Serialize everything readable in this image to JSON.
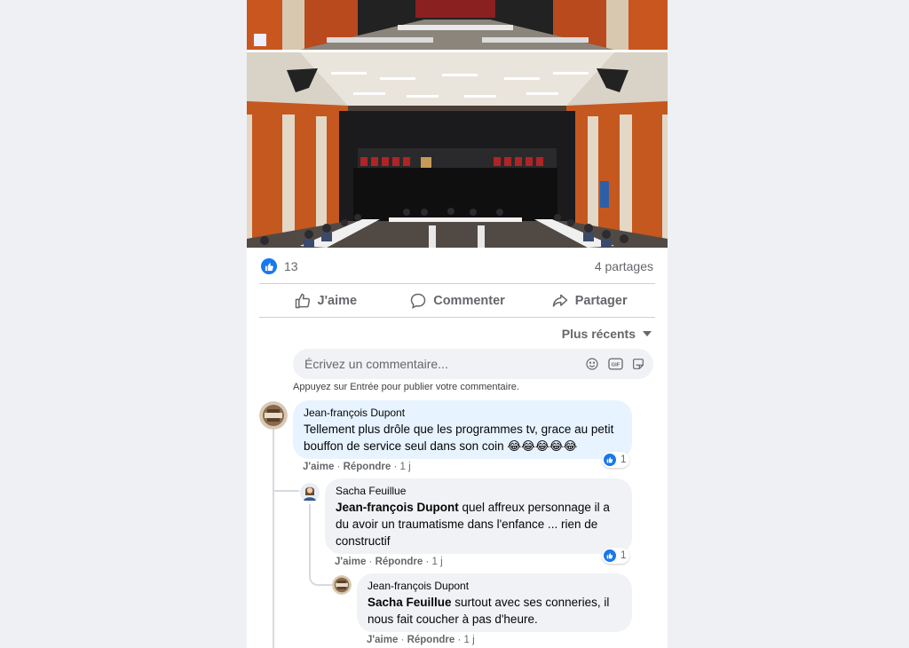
{
  "post": {
    "reaction_count": "13",
    "shares": "4 partages",
    "actions": {
      "like": "J'aime",
      "comment": "Commenter",
      "share": "Partager"
    }
  },
  "comments_section": {
    "sort_label": "Plus récents",
    "composer_placeholder": "Écrivez un commentaire...",
    "composer_hint": "Appuyez sur Entrée pour publier votre commentaire."
  },
  "comments": [
    {
      "author": "Jean-françois Dupont",
      "text": "Tellement plus drôle que les programmes tv, grace au petit bouffon de service seul dans son coin 😂😂😂😂😂",
      "like": "J'aime",
      "reply": "Répondre",
      "time": "1 j",
      "reactions": "1"
    },
    {
      "author": "Sacha Feuillue",
      "mention": "Jean-françois Dupont",
      "text": " quel affreux personnage il a du avoir un traumatisme dans l'enfance ... rien de constructif",
      "like": "J'aime",
      "reply": "Répondre",
      "time": "1 j",
      "reactions": "1"
    },
    {
      "author": "Jean-françois Dupont",
      "mention": "Sacha Feuillue",
      "text": " surtout avec ses conneries, il nous fait coucher à pas d'heure.",
      "like": "J'aime",
      "reply": "Répondre",
      "time": "1 j"
    }
  ],
  "colors": {
    "accent": "#1877f2",
    "secondary_text": "#65676b",
    "bubble": "#f0f2f5",
    "bubble_highlight": "#e7f3ff"
  }
}
